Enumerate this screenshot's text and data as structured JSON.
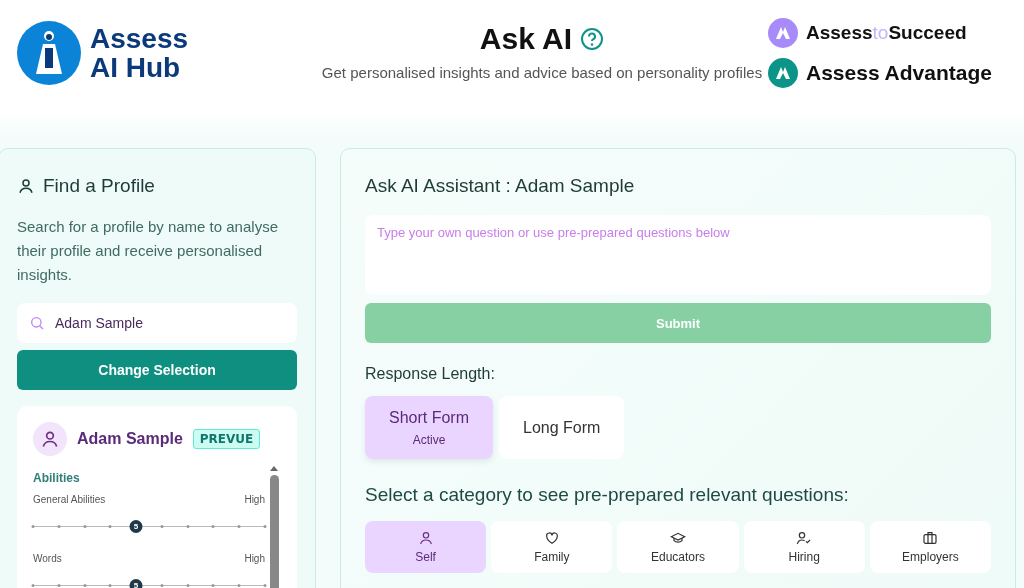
{
  "header": {
    "logo_lines": [
      "Assess",
      "AI Hub"
    ],
    "title": "Ask AI",
    "subtitle": "Get personalised insights and advice based on personality profiles",
    "brands": [
      {
        "parts": [
          {
            "text": "Assess",
            "light": false
          },
          {
            "text": "to",
            "light": true
          },
          {
            "text": "Succeed",
            "light": false
          }
        ],
        "color": "#a78bfa"
      },
      {
        "parts": [
          {
            "text": "Assess Advantage",
            "light": false
          }
        ],
        "color": "#0d9488"
      }
    ]
  },
  "find_profile": {
    "title": "Find a Profile",
    "description": "Search for a profile by name to analyse their profile and receive personalised insights.",
    "search": {
      "value": "Adam Sample"
    },
    "button": "Change Selection",
    "profile": {
      "name": "Adam Sample",
      "badge": "PREVUE",
      "section": "Abilities",
      "traits": [
        {
          "name": "General Abilities",
          "rating": "High",
          "score": "5",
          "level": 0.444
        },
        {
          "name": "Words",
          "rating": "High",
          "score": "5",
          "level": 0.444
        }
      ]
    }
  },
  "assistant": {
    "title": "Ask AI Assistant : Adam Sample",
    "question": {
      "placeholder": "Type your own question or use pre-prepared questions below"
    },
    "submit": {
      "label": "Submit",
      "disabled": true
    },
    "length_label": "Response Length:",
    "lengths": [
      {
        "label": "Short Form",
        "sub": "Active",
        "selected": true
      },
      {
        "label": "Long Form",
        "selected": false
      }
    ],
    "category_label": "Select a category to see pre-prepared relevant questions:",
    "categories": [
      {
        "label": "Self",
        "kind": "person",
        "selected": true
      },
      {
        "label": "Family",
        "kind": "heart",
        "selected": false
      },
      {
        "label": "Educators",
        "kind": "cap",
        "selected": false
      },
      {
        "label": "Hiring",
        "kind": "person-check",
        "selected": false
      },
      {
        "label": "Employers",
        "kind": "briefcase",
        "selected": false
      }
    ]
  }
}
